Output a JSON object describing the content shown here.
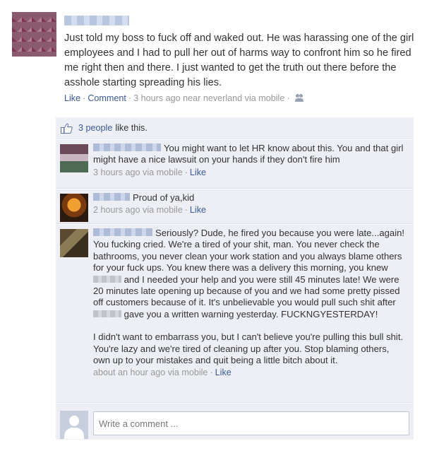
{
  "post": {
    "status": "Just told my boss to fuck off and waked out. He was harassing one of the girl employees and I had to pull her out of harms way to confront him so he fired me right then and there. I just wanted to get the truth out there before the asshole starting spreading his lies.",
    "actions": {
      "like": "Like",
      "comment": "Comment"
    },
    "meta": "3 hours ago near neverland via mobile",
    "privacy_icon": "friends-icon"
  },
  "likes": {
    "count_label": "3 people",
    "suffix": "like this.",
    "icon": "thumb-up-icon"
  },
  "comments": [
    {
      "text": "You might want to let HR know about this. You and that girl might have a nice lawsuit on your hands if they don't fire him",
      "time": "3 hours ago via mobile",
      "like": "Like"
    },
    {
      "text": "Proud of ya,kid",
      "time": "2 hours ago via mobile",
      "like": "Like"
    },
    {
      "text_a": "Seriously? Dude, he fired you because you were late...again! You fucking cried. We're a tired of your shit, man. You never check the bathrooms, you never clean your work station and you always blame others for your fuck ups. You knew there was a delivery this morning, you knew",
      "text_b": "and I needed your help and you were still 45 minutes late! We were 20 minutes late opening up because of you and we had some pretty pissed off customers because of it. It's unbelievable you would pull such shit after",
      "text_c": "gave you a written warning yesterday. FUCKNGYESTERDAY!",
      "text_d": "I didn't want to embarrass you, but I can't believe you're pulling this bull shit. You're lazy and we're tired of cleaning up after you. Stop blaming others, own up to your mistakes and quit being a little bitch about it.",
      "time": "about an hour ago via mobile",
      "like": "Like"
    }
  ],
  "composer": {
    "placeholder": "Write a comment ..."
  }
}
